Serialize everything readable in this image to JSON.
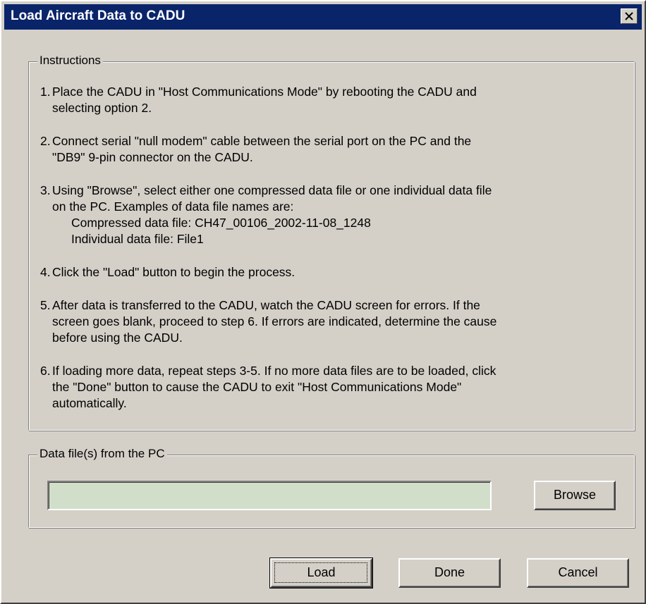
{
  "window": {
    "title": "Load Aircraft Data to CADU",
    "close_icon": "close-icon"
  },
  "instructions": {
    "legend": "Instructions",
    "steps": [
      {
        "num": "1.",
        "text": "Place the CADU in \"Host Communications Mode\" by rebooting the CADU and\nselecting option 2."
      },
      {
        "num": "2.",
        "text": "Connect serial \"null modem\" cable between the serial port on the PC and the\n\"DB9\" 9-pin connector on the CADU."
      },
      {
        "num": "3.",
        "text": "Using \"Browse\", select either one compressed data file or one individual data file\non the PC. Examples of data file names are:"
      },
      {
        "num": "4.",
        "text": "Click the \"Load\" button to begin the process."
      },
      {
        "num": "5.",
        "text": "After data is transferred to the CADU, watch the CADU screen for errors. If the\nscreen goes blank, proceed to step 6. If errors are indicated, determine the cause\nbefore using the CADU."
      },
      {
        "num": "6.",
        "text": "If loading more data, repeat steps 3-5. If no more data files are to be loaded, click\nthe \"Done\" button to cause the CADU to exit \"Host Communications Mode\"\nautomatically."
      }
    ],
    "examples": {
      "compressed": "Compressed data file:  CH47_00106_2002-11-08_1248",
      "individual": "Individual data file: File1"
    }
  },
  "datafile": {
    "legend": "Data file(s) from the PC",
    "value": "",
    "placeholder": "",
    "browse_label": "Browse"
  },
  "buttons": {
    "load_label": "Load",
    "done_label": "Done",
    "cancel_label": "Cancel"
  },
  "colors": {
    "titlebar": "#0a246a",
    "dialog_face": "#d4d0c8",
    "input_bg": "#d1dec9"
  }
}
